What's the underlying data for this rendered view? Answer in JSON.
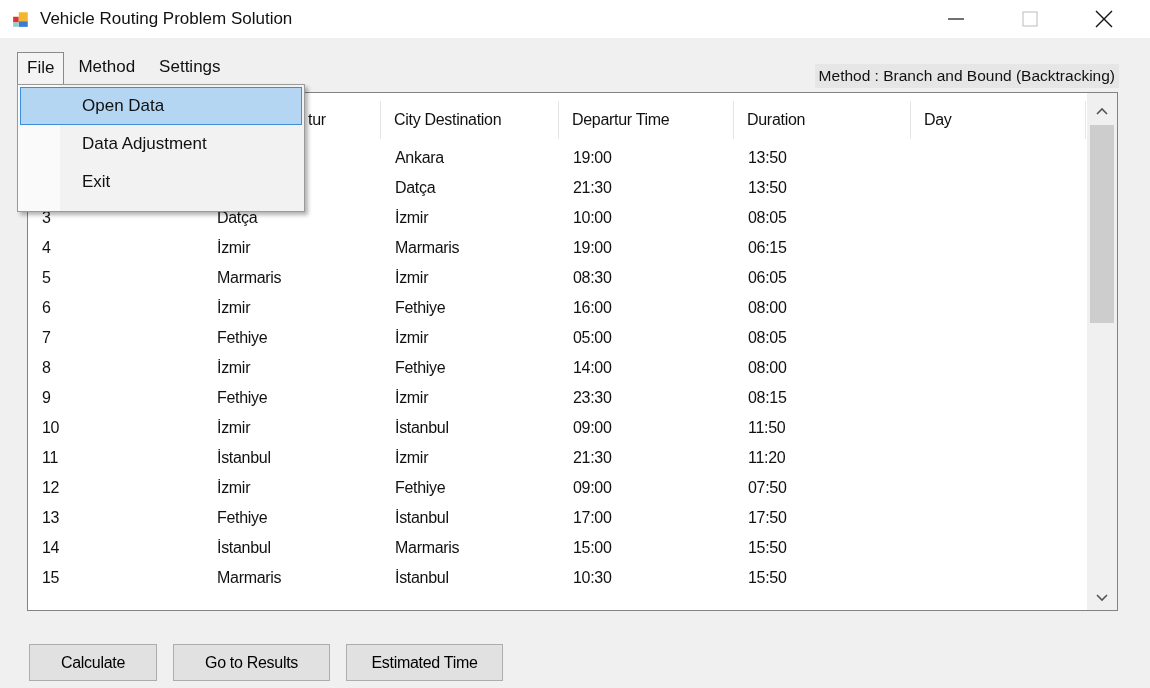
{
  "window": {
    "title": "Vehicle Routing Problem Solution"
  },
  "menu": [
    {
      "label": "File",
      "selected": true
    },
    {
      "label": "Method",
      "selected": false
    },
    {
      "label": "Settings",
      "selected": false
    }
  ],
  "dropdown": [
    {
      "label": "Open Data",
      "selected": true
    },
    {
      "label": "Data Adjustment",
      "selected": false
    },
    {
      "label": "Exit",
      "selected": false
    }
  ],
  "method_label": "Method : Branch and Bound (Backtracking)",
  "table": {
    "columns": [
      "",
      "tur",
      "City Destination",
      "Departur Time",
      "Duration",
      "Day"
    ],
    "rows": [
      {
        "to": "Ankara",
        "time": "19:00",
        "duration": "13:50"
      },
      {
        "to": "Datça",
        "time": "21:30",
        "duration": "13:50"
      },
      {
        "no": "3",
        "from": "Datça",
        "to": "İzmir",
        "time": "10:00",
        "duration": "08:05"
      },
      {
        "no": "4",
        "from": "İzmir",
        "to": "Marmaris",
        "time": "19:00",
        "duration": "06:15"
      },
      {
        "no": "5",
        "from": "Marmaris",
        "to": "İzmir",
        "time": "08:30",
        "duration": "06:05"
      },
      {
        "no": "6",
        "from": "İzmir",
        "to": "Fethiye",
        "time": "16:00",
        "duration": "08:00"
      },
      {
        "no": "7",
        "from": "Fethiye",
        "to": "İzmir",
        "time": "05:00",
        "duration": "08:05"
      },
      {
        "no": "8",
        "from": "İzmir",
        "to": "Fethiye",
        "time": "14:00",
        "duration": "08:00"
      },
      {
        "no": "9",
        "from": "Fethiye",
        "to": "İzmir",
        "time": "23:30",
        "duration": "08:15"
      },
      {
        "no": "10",
        "from": "İzmir",
        "to": "İstanbul",
        "time": "09:00",
        "duration": "11:50"
      },
      {
        "no": "11",
        "from": "İstanbul",
        "to": "İzmir",
        "time": "21:30",
        "duration": "11:20"
      },
      {
        "no": "12",
        "from": "İzmir",
        "to": "Fethiye",
        "time": "09:00",
        "duration": "07:50"
      },
      {
        "no": "13",
        "from": "Fethiye",
        "to": "İstanbul",
        "time": "17:00",
        "duration": "17:50"
      },
      {
        "no": "14",
        "from": "İstanbul",
        "to": "Marmaris",
        "time": "15:00",
        "duration": "15:50"
      },
      {
        "no": "15",
        "from": "Marmaris",
        "to": "İstanbul",
        "time": "10:30",
        "duration": "15:50"
      }
    ]
  },
  "buttons": [
    "Calculate",
    "Go to Results",
    "Estimated Time"
  ]
}
